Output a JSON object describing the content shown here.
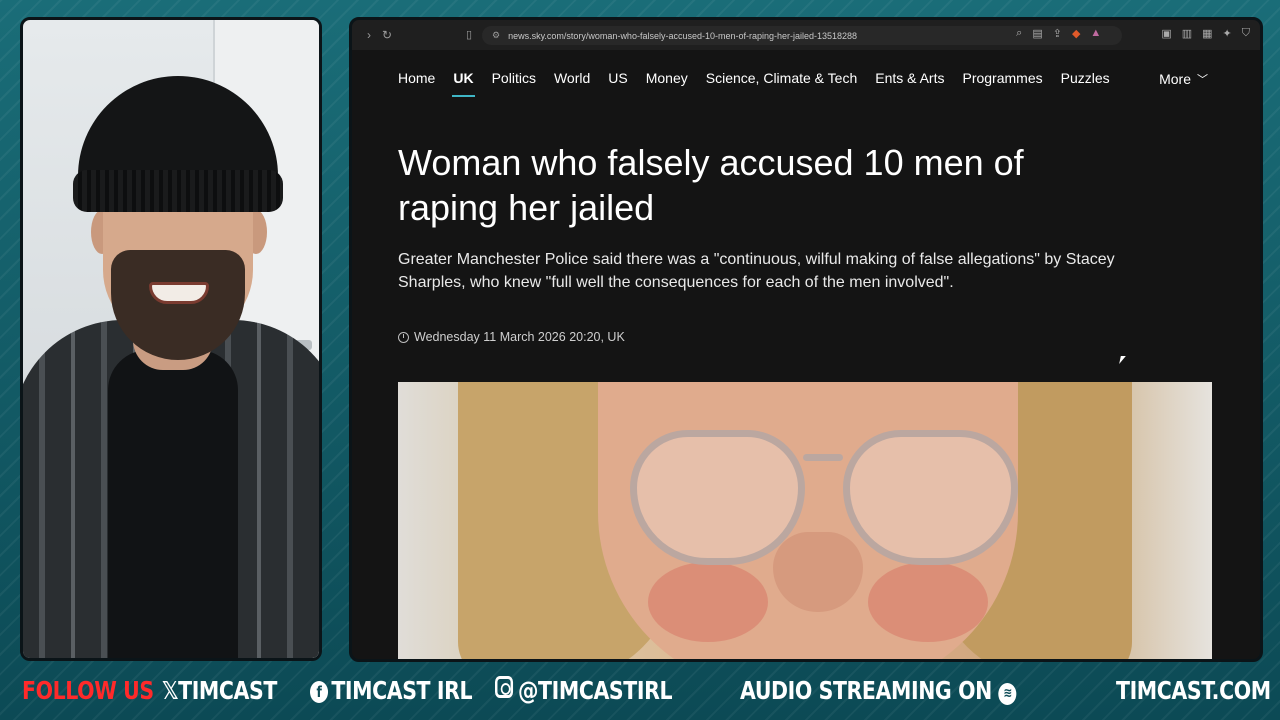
{
  "browser": {
    "url": "news.sky.com/story/woman-who-falsely-accused-10-men-of-raping-her-jailed-13518288"
  },
  "site_nav": {
    "items": [
      "Home",
      "UK",
      "Politics",
      "World",
      "US",
      "Money",
      "Science, Climate & Tech",
      "Ents & Arts",
      "Programmes",
      "Puzzles"
    ],
    "active": "UK",
    "more_label": "More"
  },
  "article": {
    "headline": "Woman who falsely accused 10 men of raping her jailed",
    "standfirst": "Greater Manchester Police said there was a \"continuous, wilful making of false allegations\" by Stacey Sharples, who knew \"full well the consequences for each of the men involved\".",
    "date": "Wednesday 11 March 2026 20:20, UK"
  },
  "banner": {
    "follow": "FOLLOW US",
    "x_handle": "TIMCAST",
    "fb_handle": "TIMCAST IRL",
    "ig_handle": "@TIMCASTIRL",
    "audio": "AUDIO STREAMING ON",
    "site": "TIMCAST.COM"
  },
  "colors": {
    "accent": "#3fb6c6",
    "follow_red": "#ff2a2a",
    "page_bg": "#141414"
  }
}
